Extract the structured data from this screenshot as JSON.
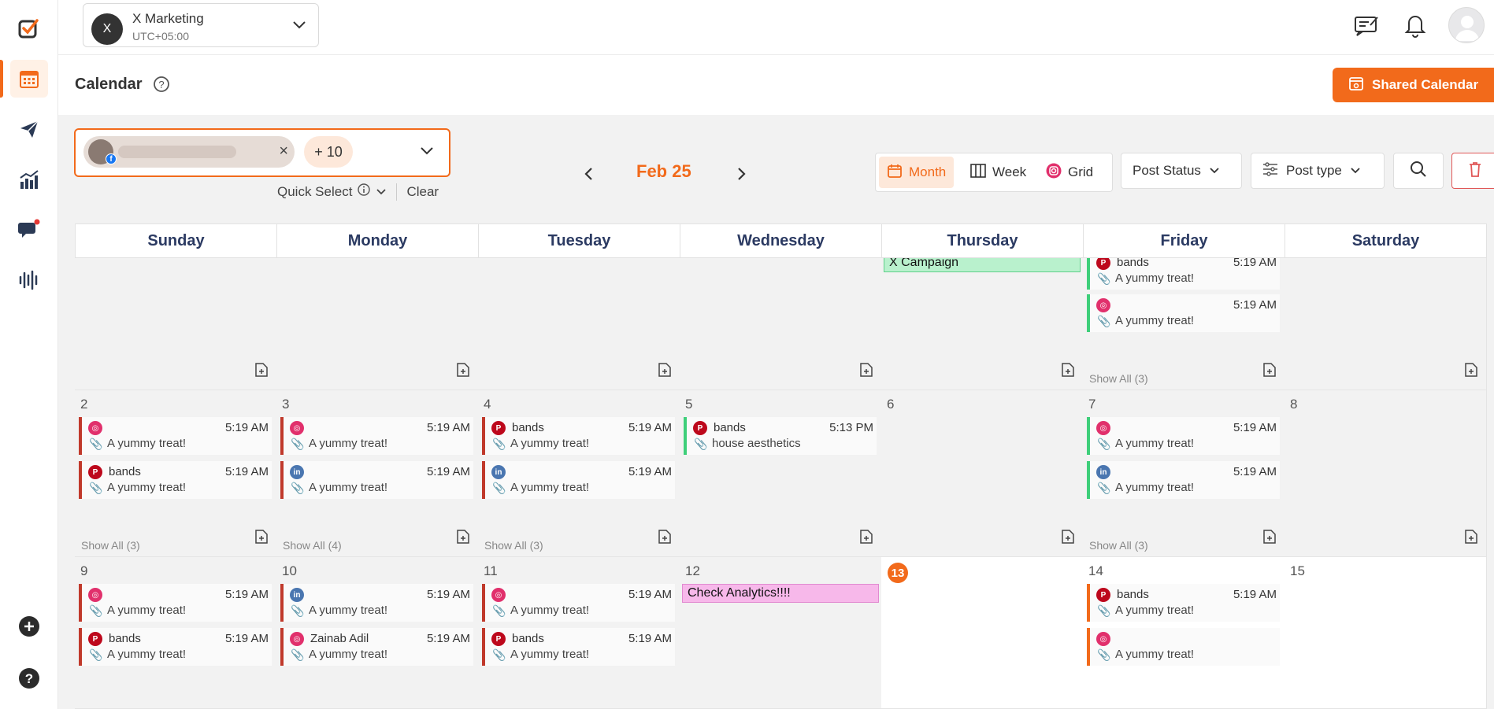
{
  "workspace": {
    "initial": "X",
    "name": "X Marketing",
    "timezone": "UTC+05:00"
  },
  "header": {
    "title": "Calendar",
    "shared_calendar": "Shared Calendar"
  },
  "filters": {
    "more_accounts": "+ 10",
    "quick_select": "Quick Select",
    "clear": "Clear",
    "month": "Feb 25",
    "views": {
      "month": "Month",
      "week": "Week",
      "grid": "Grid"
    },
    "post_status": "Post Status",
    "post_type": "Post type"
  },
  "weekdays": [
    "Sunday",
    "Monday",
    "Tuesday",
    "Wednesday",
    "Thursday",
    "Friday",
    "Saturday"
  ],
  "week1": {
    "thursday_event": "X Campaign",
    "friday_posts": [
      {
        "platform": "pin",
        "name": "bands",
        "time": "5:19 AM",
        "caption": "A yummy treat!"
      },
      {
        "platform": "ig",
        "name": "",
        "time": "5:19 AM",
        "caption": "A yummy treat!"
      }
    ],
    "friday_show_all": "Show All (3)"
  },
  "week2": {
    "days": [
      "2",
      "3",
      "4",
      "5",
      "6",
      "7",
      "8"
    ],
    "sun_posts": [
      {
        "platform": "ig",
        "name": "",
        "time": "5:19 AM",
        "caption": "A yummy treat!"
      },
      {
        "platform": "pin",
        "name": "bands",
        "time": "5:19 AM",
        "caption": "A yummy treat!"
      }
    ],
    "sun_show_all": "Show All (3)",
    "mon_posts": [
      {
        "platform": "ig",
        "name": "",
        "time": "5:19 AM",
        "caption": "A yummy treat!"
      },
      {
        "platform": "li",
        "name": "",
        "time": "5:19 AM",
        "caption": "A yummy treat!"
      }
    ],
    "mon_show_all": "Show All (4)",
    "tue_posts": [
      {
        "platform": "pin",
        "name": "bands",
        "time": "5:19 AM",
        "caption": "A yummy treat!"
      },
      {
        "platform": "li",
        "name": "",
        "time": "5:19 AM",
        "caption": "A yummy treat!"
      }
    ],
    "tue_show_all": "Show All (3)",
    "wed_posts": [
      {
        "platform": "pin",
        "name": "bands",
        "time": "5:13 PM",
        "caption": "house aesthetics"
      }
    ],
    "fri_posts": [
      {
        "platform": "ig",
        "name": "",
        "time": "5:19 AM",
        "caption": "A yummy treat!"
      },
      {
        "platform": "li",
        "name": "",
        "time": "5:19 AM",
        "caption": "A yummy treat!"
      }
    ],
    "fri_show_all": "Show All (3)"
  },
  "week3": {
    "days": [
      "9",
      "10",
      "11",
      "12",
      "13",
      "14",
      "15"
    ],
    "sun_posts": [
      {
        "platform": "ig",
        "name": "",
        "time": "5:19 AM",
        "caption": "A yummy treat!"
      },
      {
        "platform": "pin",
        "name": "bands",
        "time": "5:19 AM",
        "caption": "A yummy treat!"
      }
    ],
    "mon_posts": [
      {
        "platform": "li",
        "name": "",
        "time": "5:19 AM",
        "caption": "A yummy treat!"
      },
      {
        "platform": "ig",
        "name": "Zainab Adil",
        "time": "5:19 AM",
        "caption": "A yummy treat!"
      }
    ],
    "tue_posts": [
      {
        "platform": "ig",
        "name": "",
        "time": "5:19 AM",
        "caption": "A yummy treat!"
      },
      {
        "platform": "pin",
        "name": "bands",
        "time": "5:19 AM",
        "caption": "A yummy treat!"
      }
    ],
    "wed_event": "Check Analytics!!!!",
    "fri_posts": [
      {
        "platform": "pin",
        "name": "bands",
        "time": "5:19 AM",
        "caption": "A yummy treat!"
      },
      {
        "platform": "ig",
        "name": "",
        "time": "",
        "caption": "A yummy treat!"
      }
    ]
  },
  "colors": {
    "accent": "#f26a1b",
    "instagram": "#e1306c",
    "pinterest": "#bd081c",
    "linkedin": "#4a76b0"
  }
}
